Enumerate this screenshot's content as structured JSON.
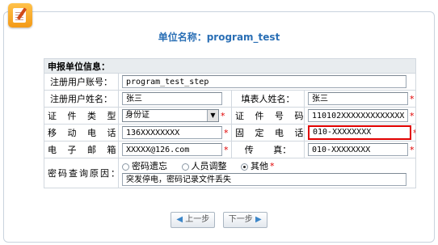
{
  "page": {
    "title": "单位名称：program_test"
  },
  "section": {
    "title": "申报单位信息："
  },
  "fields": {
    "account": {
      "label": "注册用户账号：",
      "value": "program_test_step"
    },
    "name": {
      "label": "注册用户姓名：",
      "value": "张三"
    },
    "filler": {
      "label": "填表人姓名：",
      "value": "张三"
    },
    "id_type": {
      "label": "证 件 类 型：",
      "value": "身份证"
    },
    "id_number": {
      "label": "证 件 号 码：",
      "value": "110102XXXXXXXXXXXXX"
    },
    "mobile": {
      "label": "移 动 电 话：",
      "value": "136XXXXXXXX"
    },
    "phone": {
      "label": "固 定 电 话：",
      "value": "010-XXXXXXXX"
    },
    "email": {
      "label": "电 子 邮 箱：",
      "value": "XXXXX@126.com"
    },
    "fax": {
      "label": "传       真：",
      "value": "010-XXXXXXXX"
    }
  },
  "reason": {
    "label": "密码查询原因：",
    "options": [
      "密码遗忘",
      "人员调整",
      "其他"
    ],
    "selected_index": 2,
    "text": "突发停电，密码记录文件丢失"
  },
  "required_mark": "*",
  "buttons": {
    "prev": "上一步",
    "next": "下一步"
  },
  "colors": {
    "accent": "#2a6fb5",
    "required": "#e00000",
    "highlight_border": "#e00000"
  }
}
